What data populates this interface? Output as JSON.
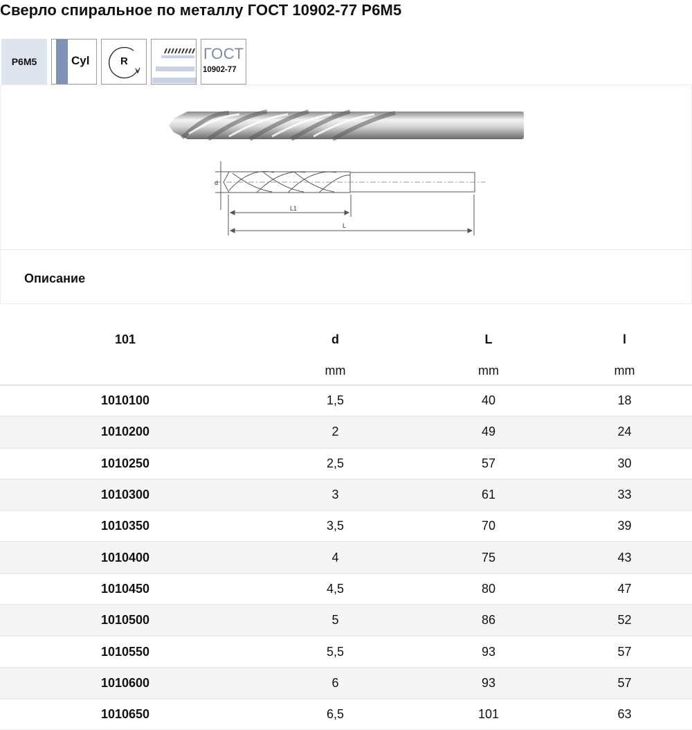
{
  "page": {
    "title": "Сверло спиральное по металлу ГОСТ 10902-77 Р6М5"
  },
  "badges": {
    "material": "P6M5",
    "shank": "Cyl",
    "rotation": "R",
    "standard_line1": "ГОСТ",
    "standard_line2": "10902-77"
  },
  "drawing": {
    "label_d": "d",
    "label_l1": "L1",
    "label_l": "L"
  },
  "description": {
    "title": "Описание"
  },
  "table": {
    "headers": [
      "101",
      "d",
      "L",
      "l"
    ],
    "units": [
      "",
      "mm",
      "mm",
      "mm"
    ],
    "rows": [
      [
        "1010100",
        "1,5",
        "40",
        "18"
      ],
      [
        "1010200",
        "2",
        "49",
        "24"
      ],
      [
        "1010250",
        "2,5",
        "57",
        "30"
      ],
      [
        "1010300",
        "3",
        "61",
        "33"
      ],
      [
        "1010350",
        "3,5",
        "70",
        "39"
      ],
      [
        "1010400",
        "4",
        "75",
        "43"
      ],
      [
        "1010450",
        "4,5",
        "80",
        "47"
      ],
      [
        "1010500",
        "5",
        "86",
        "52"
      ],
      [
        "1010550",
        "5,5",
        "93",
        "57"
      ],
      [
        "1010600",
        "6",
        "93",
        "57"
      ],
      [
        "1010650",
        "6,5",
        "101",
        "63"
      ]
    ]
  },
  "colors": {
    "material_badge_bg": "#dfe5ee",
    "shank_bar": "#7f93b7",
    "gost_text": "#7a8aa8",
    "row_alt": "#f5f5f5"
  },
  "icons": [
    "cylindrical-shank-icon",
    "right-rotation-icon",
    "drill-flute-icon"
  ]
}
